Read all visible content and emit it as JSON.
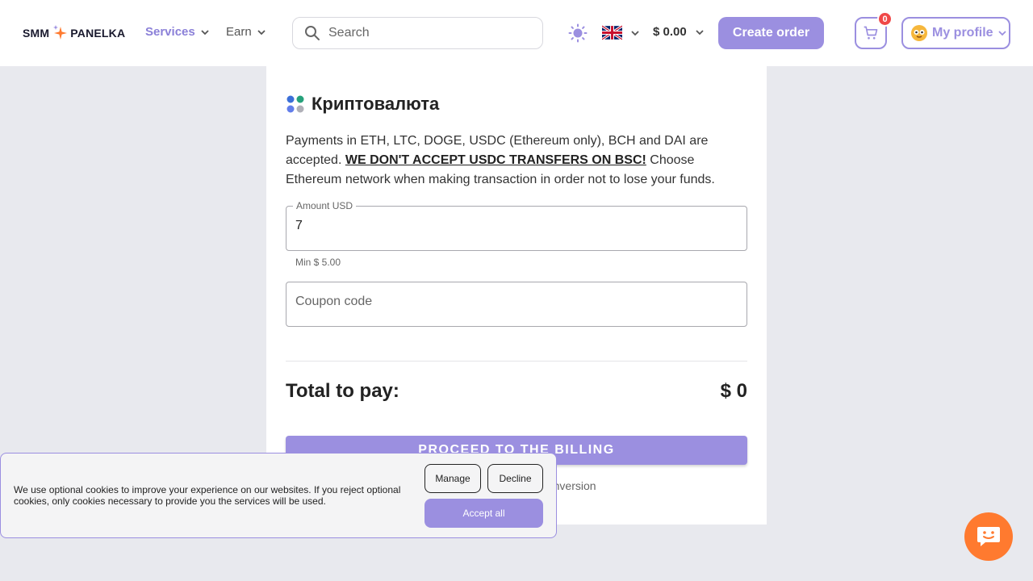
{
  "header": {
    "logo_left": "SMM",
    "logo_right": "PANELKA",
    "nav": {
      "services": "Services",
      "earn": "Earn"
    },
    "search_placeholder": "Search",
    "balance": "$ 0.00",
    "create_order": "Create order",
    "cart_count": "0",
    "profile": "My profile"
  },
  "payment": {
    "title": "Криптовалюта",
    "description_1": "Payments in ETH, LTC, DOGE, USDC (Ethereum only), BCH and DAI are accepted.",
    "warning": "WE DON'T ACCEPT USDC TRANSFERS ON BSC!",
    "description_2": " Choose Ethereum network when making transaction in order not to lose your funds.",
    "amount_label": "Amount USD",
    "amount_value": "7",
    "amount_hint": "Min $ 5.00",
    "coupon_placeholder": "Coupon code",
    "total_label": "Total to pay:",
    "total_value": "$ 0",
    "proceed": "PROCEED TO THE BILLING",
    "note_partial": "urrency, conversion"
  },
  "cookie": {
    "text": "We use optional cookies to improve your experience on our websites. If you reject optional cookies, only cookies necessary to provide you the services will be used.",
    "manage": "Manage",
    "decline": "Decline",
    "accept": "Accept all"
  },
  "colors": {
    "accent": "#9b8fe0",
    "badge": "#f04848",
    "chat": "#ff7a2f",
    "background": "#e8e9ee"
  },
  "icons": [
    "sparkle-star-icon",
    "chevron-down-icon",
    "search-icon",
    "sun-icon",
    "uk-flag-icon",
    "cart-icon",
    "avatar-icon",
    "crypto-icon",
    "chat-icon"
  ]
}
